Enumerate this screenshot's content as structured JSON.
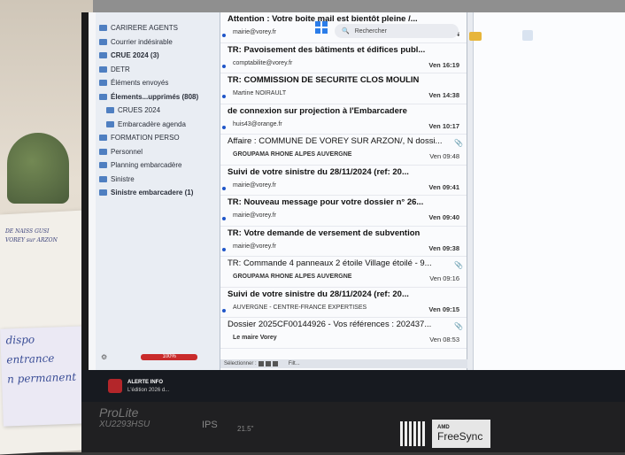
{
  "folders": [
    {
      "label": "CARIRERE AGENTS",
      "bold": false,
      "sub": false
    },
    {
      "label": "Courrier indésirable",
      "bold": false,
      "sub": false
    },
    {
      "label": "CRUE 2024 (3)",
      "bold": true,
      "sub": false
    },
    {
      "label": "DETR",
      "bold": false,
      "sub": false
    },
    {
      "label": "Éléments envoyés",
      "bold": false,
      "sub": false
    },
    {
      "label": "Élements...upprimés (808)",
      "bold": true,
      "sub": false
    },
    {
      "label": "CRUES 2024",
      "bold": false,
      "sub": true
    },
    {
      "label": "Embarcadère agenda",
      "bold": false,
      "sub": true
    },
    {
      "label": "FORMATION PERSO",
      "bold": false,
      "sub": false
    },
    {
      "label": "Personnel",
      "bold": false,
      "sub": false
    },
    {
      "label": "Planning embarcadère",
      "bold": false,
      "sub": false
    },
    {
      "label": "Sinistre",
      "bold": false,
      "sub": false
    },
    {
      "label": "Sinistre embarcadere (1)",
      "bold": true,
      "sub": false
    }
  ],
  "quota": {
    "label": "100%",
    "color": "#c92b2b"
  },
  "messages": [
    {
      "subject": "Attention : Votre boite mail est bientôt pleine /...",
      "sender": "mairie@vorey.fr",
      "time": "Ven 16:44",
      "unread": true,
      "attachment": false
    },
    {
      "subject": "TR: Pavoisement des bâtiments et édifices publ...",
      "sender": "comptabilite@vorey.fr",
      "time": "Ven 16:19",
      "unread": true,
      "attachment": false
    },
    {
      "subject": "TR: COMMISSION DE SECURITE CLOS MOULIN",
      "sender": "Martine NOIRAULT",
      "time": "Ven 14:38",
      "unread": true,
      "attachment": false
    },
    {
      "subject": "de connexion sur projection à l'Embarcadere",
      "sender": "huis43@orange.fr",
      "time": "Ven 10:17",
      "unread": true,
      "attachment": false
    },
    {
      "subject": "Affaire : COMMUNE DE VOREY SUR ARZON/, N dossi...",
      "sender": "GROUPAMA RHONE ALPES AUVERGNE",
      "time": "Ven 09:48",
      "unread": false,
      "attachment": true
    },
    {
      "subject": "Suivi de votre sinistre du 28/11/2024 (ref: 20...",
      "sender": "mairie@vorey.fr",
      "time": "Ven 09:41",
      "unread": true,
      "attachment": false
    },
    {
      "subject": "TR: Nouveau message pour votre dossier n° 26...",
      "sender": "mairie@vorey.fr",
      "time": "Ven 09:40",
      "unread": true,
      "attachment": false
    },
    {
      "subject": "TR: Votre demande de versement de subvention",
      "sender": "mairie@vorey.fr",
      "time": "Ven 09:38",
      "unread": true,
      "attachment": false
    },
    {
      "subject": "TR: Commande 4 panneaux 2 étoile Village étoilé - 9...",
      "sender": "GROUPAMA RHONE ALPES AUVERGNE",
      "time": "Ven 09:16",
      "unread": false,
      "attachment": true
    },
    {
      "subject": "Suivi de votre sinistre du 28/11/2024 (ref: 20...",
      "sender": "AUVERGNE - CENTRE-FRANCE EXPERTISES",
      "time": "Ven 09:15",
      "unread": true,
      "attachment": false
    },
    {
      "subject": "Dossier 2025CF00144926 - Vos références : 202437...",
      "sender": "Le maire Vorey",
      "time": "Ven 08:53",
      "unread": false,
      "attachment": true
    }
  ],
  "mail_status": {
    "select_label": "Sélectionner :",
    "filter_label": "Filt..."
  },
  "taskbar": {
    "alert_title": "ALERTE INFO",
    "alert_sub": "L'édition 2026 d...",
    "search_placeholder": "Rechercher"
  },
  "monitor": {
    "brand": "ProLite",
    "model": "XU2293HSU",
    "panel": "IPS",
    "size": "21.5\"",
    "amd_label": "AMD",
    "freesync_label": "FreeSync"
  },
  "note": {
    "paper_lines": [
      "DE NAISS GUSI",
      "VOREY sur ARZON"
    ],
    "sticky_lines": [
      "dispo",
      "entrance",
      "n permanent"
    ]
  }
}
